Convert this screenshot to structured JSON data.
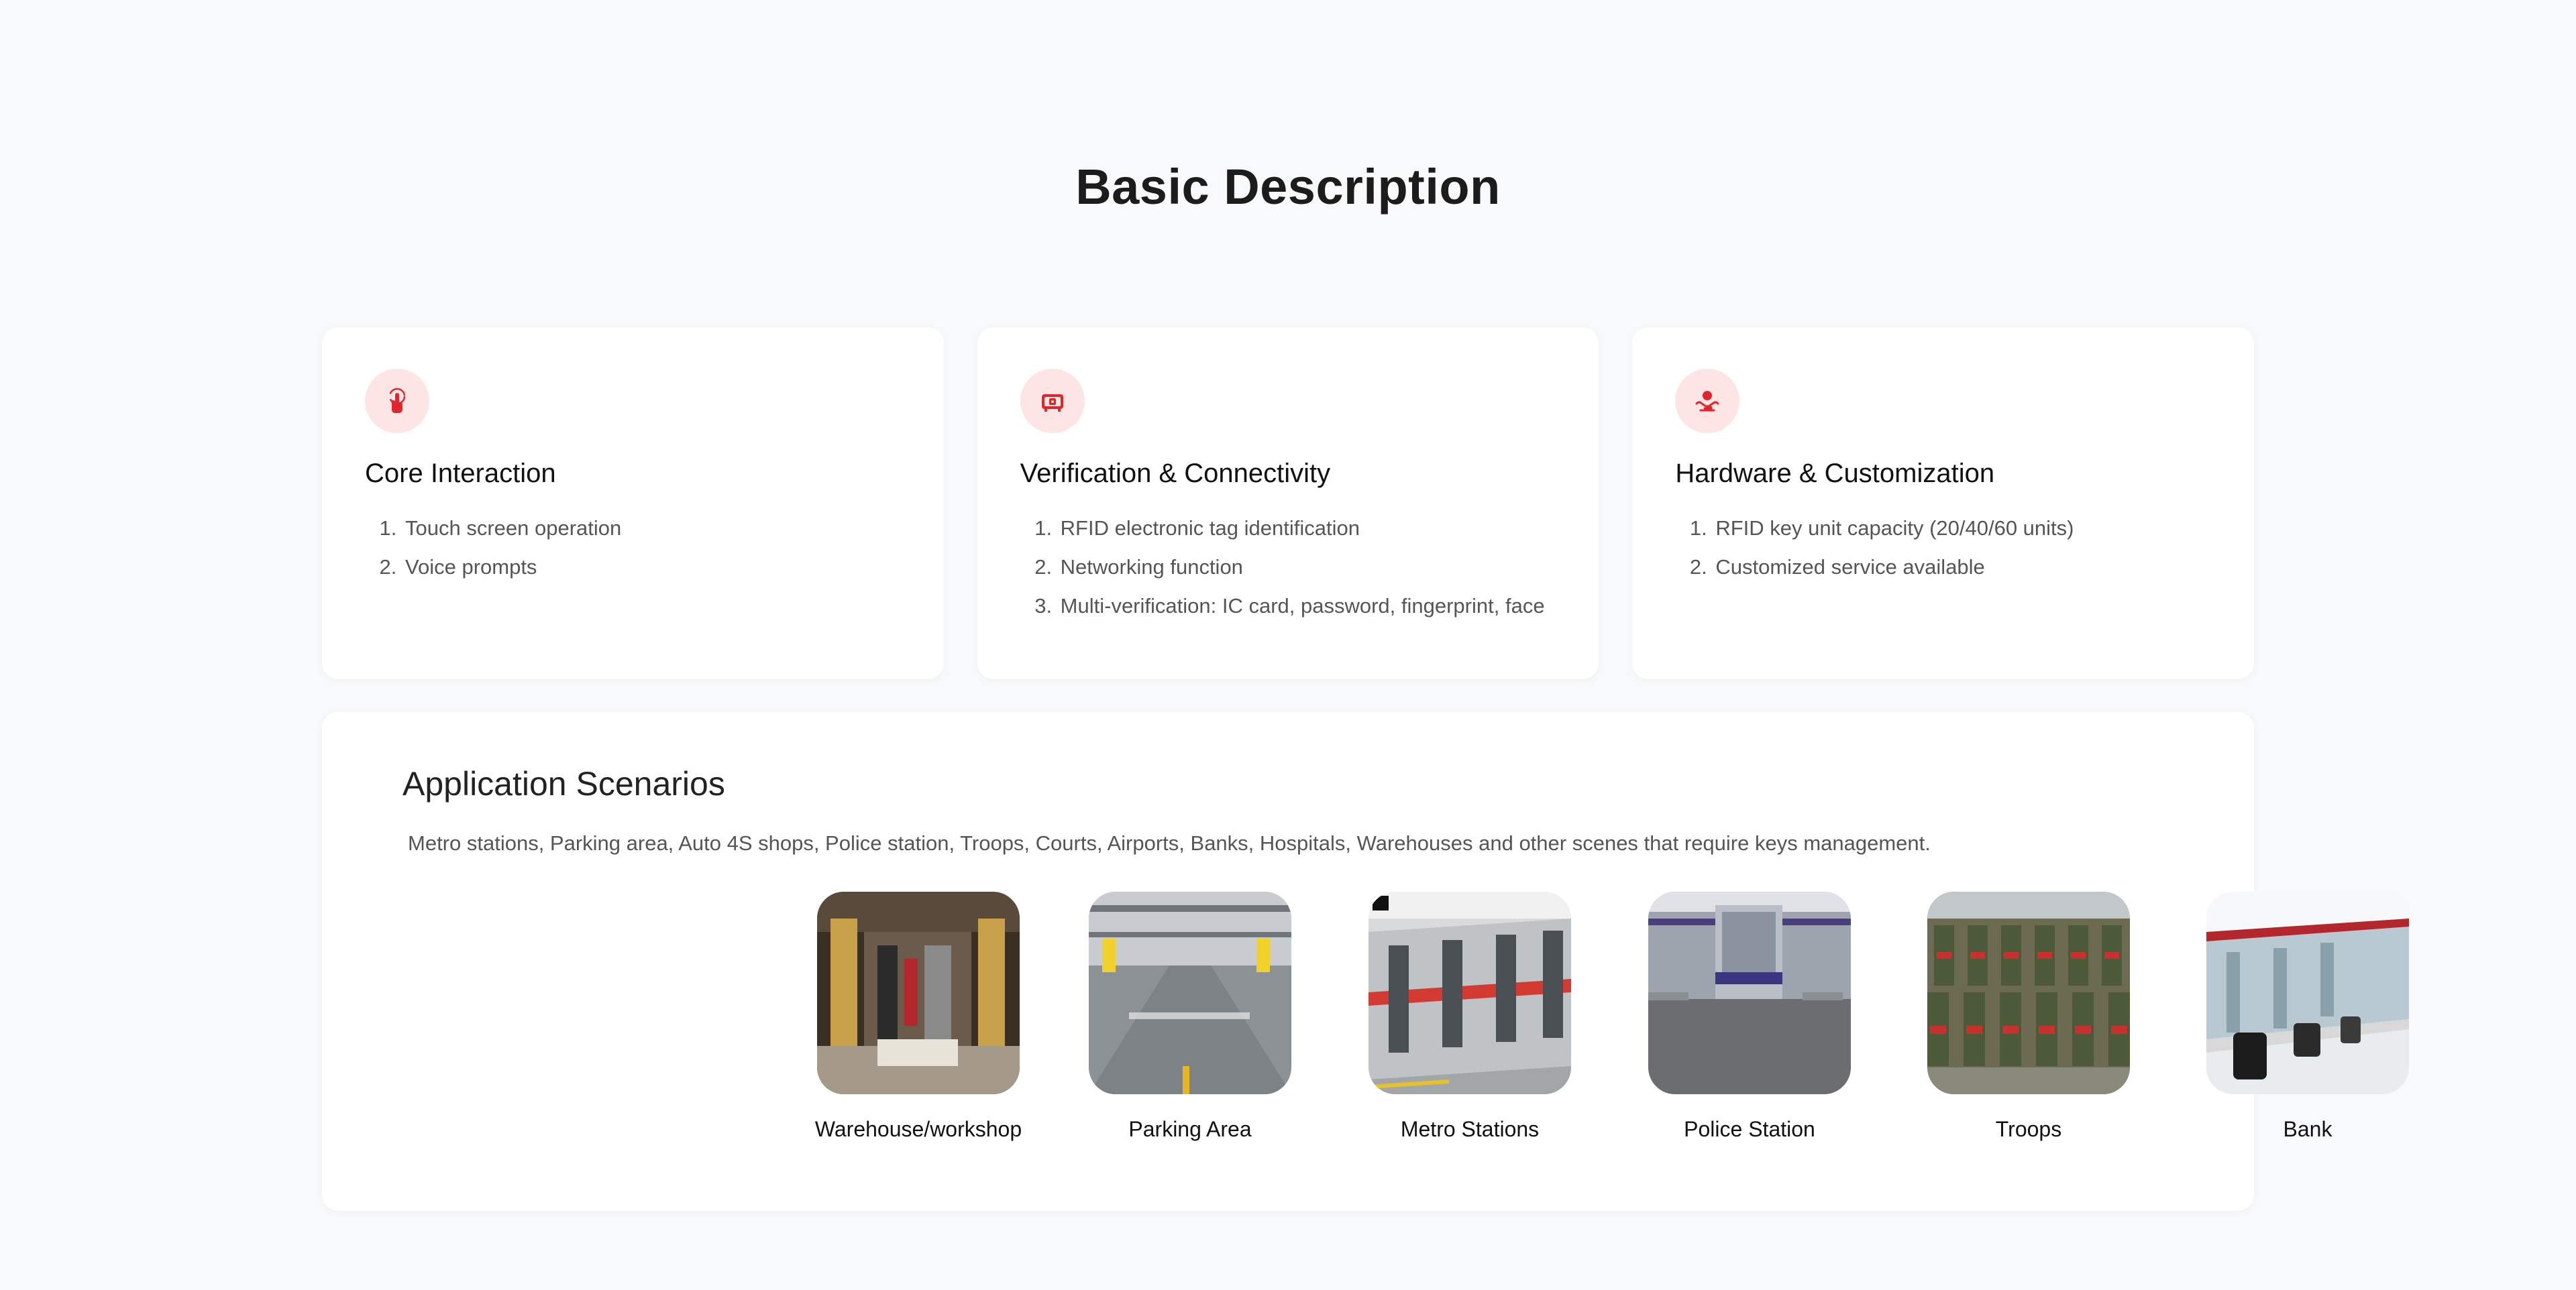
{
  "page": {
    "title": "Basic Description"
  },
  "features": [
    {
      "icon": "touch-icon",
      "title": "Core Interaction",
      "items": [
        "Touch screen operation",
        "Voice prompts"
      ]
    },
    {
      "icon": "rfid-icon",
      "title": "Verification & Connectivity",
      "items": [
        "RFID electronic tag identification",
        "Networking function",
        "Multi-verification: IC card, password, fingerprint, face"
      ]
    },
    {
      "icon": "hand-customization-icon",
      "title": "Hardware & Customization",
      "items": [
        "RFID key unit capacity (20/40/60 units)",
        "Customized service available"
      ]
    }
  ],
  "scenarios": {
    "title": "Application Scenarios",
    "description": "Metro stations, Parking area, Auto 4S shops, Police station, Troops, Courts, Airports, Banks, Hospitals, Warehouses and other scenes that require keys management.",
    "items": [
      {
        "label": "Warehouse/workshop",
        "image": "warehouse-photo"
      },
      {
        "label": "Parking Area",
        "image": "parking-photo"
      },
      {
        "label": "Metro Stations",
        "image": "metro-photo"
      },
      {
        "label": "Police Station",
        "image": "police-station-photo"
      },
      {
        "label": "Troops",
        "image": "troops-photo"
      },
      {
        "label": "Bank",
        "image": "bank-photo"
      }
    ]
  },
  "colors": {
    "accent": "#e0262b",
    "icon_bg": "#fde5e5",
    "background": "#f8f9fb",
    "card": "#ffffff"
  }
}
